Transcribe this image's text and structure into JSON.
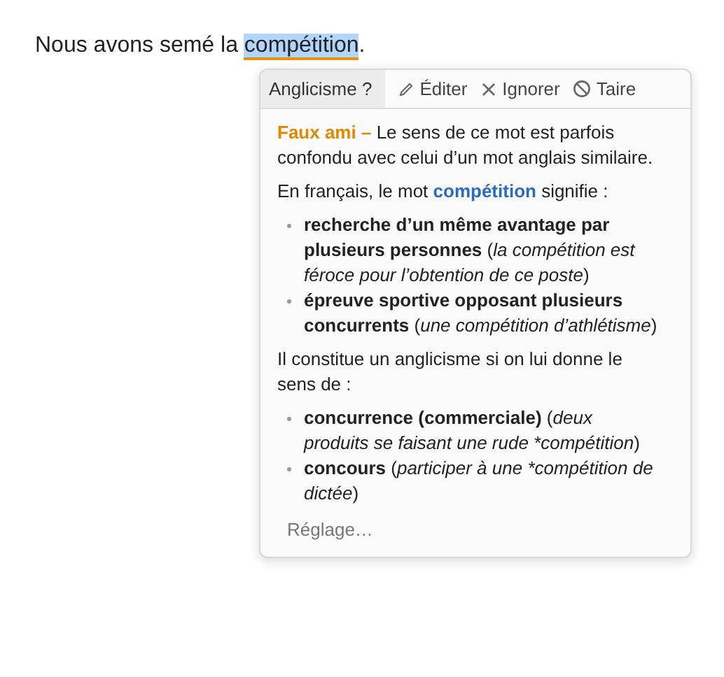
{
  "sentence": {
    "before": "Nous avons semé la",
    "word": "compétition",
    "after": "."
  },
  "popup": {
    "category": "Anglicisme ?",
    "actions": [
      {
        "kind": "edit",
        "label": "Éditer"
      },
      {
        "kind": "ignore",
        "label": "Ignorer"
      },
      {
        "kind": "mute",
        "label": "Taire"
      }
    ],
    "paragraphs": [
      {
        "kind": "text",
        "color": "#e08a00",
        "text": "**Faux ami –** Le sens de ce mot est parfois confondu avec celui d’un mot anglais similaire."
      },
      {
        "kind": "text",
        "color": "#2a6bc0",
        "text": "En français, le mot **compétition** signifie :"
      },
      {
        "kind": "list",
        "items": [
          {
            "term": "recherche d’un même avantage par plusieurs personnes",
            "example": "(la compétition est féroce pour l’obtention de ce poste)"
          },
          {
            "term": "épreuve sportive opposant plusieurs concurrents",
            "example": "(une compétition d’athlétisme)"
          }
        ]
      },
      {
        "kind": "text",
        "text": "Il constitue un anglicisme si on lui donne le sens de :"
      },
      {
        "kind": "list",
        "items": [
          {
            "term": "concurrence (commerciale)",
            "example": "(deux produits se faisant une rude *compétition)"
          },
          {
            "term": "concours",
            "example": "(participer à une *compétition de dictée)"
          }
        ]
      }
    ],
    "settings_link": "Réglage…"
  }
}
